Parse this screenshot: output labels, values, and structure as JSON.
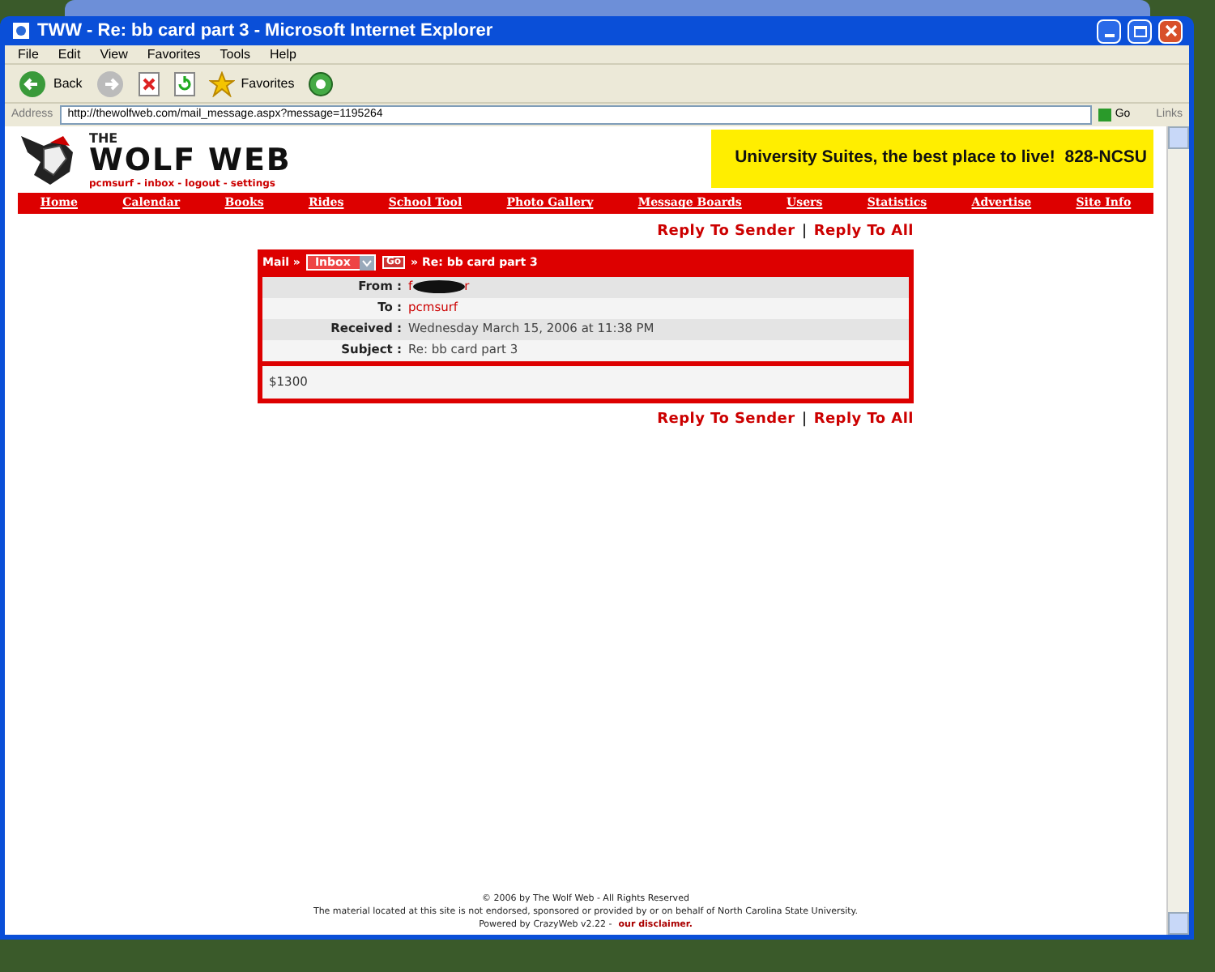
{
  "window": {
    "title": "TWW - Re: bb card part 3 - Microsoft Internet Explorer"
  },
  "menu": [
    "File",
    "Edit",
    "View",
    "Favorites",
    "Tools",
    "Help"
  ],
  "toolbar": [
    {
      "kind": "back",
      "label": "Back"
    },
    {
      "kind": "forward"
    },
    {
      "kind": "stop"
    },
    {
      "kind": "refresh"
    },
    {
      "kind": "favorites",
      "label": "Favorites"
    },
    {
      "kind": "media"
    }
  ],
  "address": {
    "label": "Address",
    "value": "http://thewolfweb.com/mail_message.aspx?message=1195264",
    "go": "Go",
    "links": "Links"
  },
  "site": {
    "logo_small": "THE",
    "logo_big": "WOLF WEB",
    "user_links": [
      "pcmsurf",
      "inbox",
      "logout",
      "settings"
    ],
    "user_link_separator": "-",
    "ad": "University Suites, the best place to live!  828-NCSU"
  },
  "nav": [
    "Home",
    "Calendar",
    "Books",
    "Rides",
    "School Tool",
    "Photo Gallery",
    "Message Boards",
    "Users",
    "Statistics",
    "Advertise",
    "Site Info"
  ],
  "reply_separator": "|",
  "reply_links_top": [
    "Reply To Sender",
    "Reply To All"
  ],
  "mail": {
    "crumb": "Mail »",
    "folder": "Inbox",
    "go": "Go",
    "subject_crumb": "» Re: bb card part 3",
    "fields": [
      {
        "label": "From :",
        "kind": "redacted",
        "value_start": "f",
        "value_end": "r"
      },
      {
        "label": "To :",
        "kind": "link",
        "value": "pcmsurf"
      },
      {
        "label": "Received :",
        "kind": "text",
        "value": "Wednesday March 15, 2006 at 11:38 PM"
      },
      {
        "label": "Subject :",
        "kind": "text",
        "value": "Re: bb card part 3"
      }
    ],
    "body": "$1300"
  },
  "reply_links_bottom": [
    "Reply To Sender",
    "Reply To All"
  ],
  "footer": {
    "line_1": "© 2006 by The Wolf Web - All Rights Reserved",
    "line_2": "The material located at this site is not endorsed, sponsored or provided by or on behalf of North Carolina State University.",
    "line_3": "Powered by CrazyWeb v2.22 -",
    "disclaimer": "our disclaimer."
  }
}
